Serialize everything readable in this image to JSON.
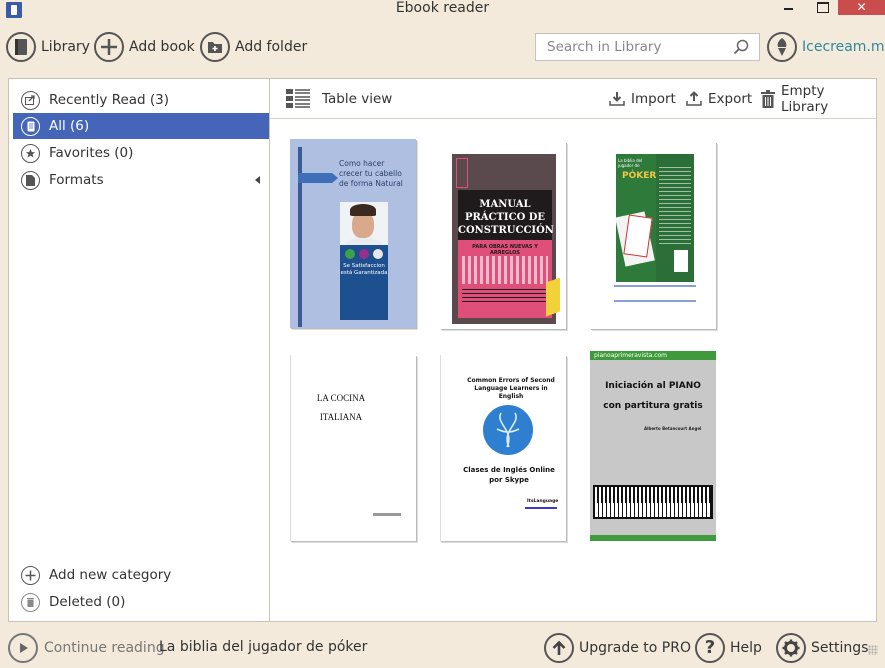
{
  "window": {
    "title": "Ebook reader",
    "close_glyph": "✕"
  },
  "toolbar": {
    "library_label": "Library",
    "add_book_label": "Add book",
    "add_folder_label": "Add folder",
    "search_placeholder": "Search in Library",
    "search_value": "",
    "brand_link": "Icecream.me"
  },
  "sidebar": {
    "items": [
      {
        "label": "Recently Read (3)",
        "icon": "recent-icon"
      },
      {
        "label": "All (6)",
        "icon": "book-icon",
        "selected": true
      },
      {
        "label": "Favorites (0)",
        "icon": "star-icon"
      },
      {
        "label": "Formats",
        "icon": "file-icon",
        "expandable": true
      }
    ],
    "add_category_label": "Add new category",
    "deleted_label": "Deleted (0)"
  },
  "main": {
    "view_label": "Table view",
    "import_label": "Import",
    "export_label": "Export",
    "empty_label": "Empty Library",
    "books": [
      {
        "title": "Como hacer crecer tu cabello de forma Natural",
        "badge_title": "Se Satisfaccion está Garantizada",
        "cover_color": "#a9bde0"
      },
      {
        "title": "MANUAL PRÁCTICO DE CONSTRUCCIÓN",
        "subtitle": "PARA OBRAS NUEVAS Y ARREGLOS",
        "cover_color": "#5a4a4e",
        "accent_color": "#e04f7a"
      },
      {
        "title": "La biblia del jugador de PÓKER",
        "cover_color": "#2e7a3b"
      },
      {
        "title_line1": "LA COCINA",
        "title_line2": "ITALIANA"
      },
      {
        "title": "Common Errors of Second Language Learners in English",
        "subtitle": "Clases de Inglés Online por Skype",
        "publisher": "ItsLanguage",
        "logo_color": "#2f7fd0"
      },
      {
        "site": "pianoaprimeravista.com",
        "title_line1": "Iniciación al PIANO",
        "title_line2": "con partitura gratis",
        "author": "Alberto Betancourt Angel",
        "bar_color": "#3f9a3c"
      }
    ]
  },
  "footer": {
    "continue_label": "Continue reading",
    "continue_title": "La biblia del jugador de póker",
    "upgrade_label": "Upgrade to PRO",
    "help_label": "Help",
    "settings_label": "Settings"
  }
}
